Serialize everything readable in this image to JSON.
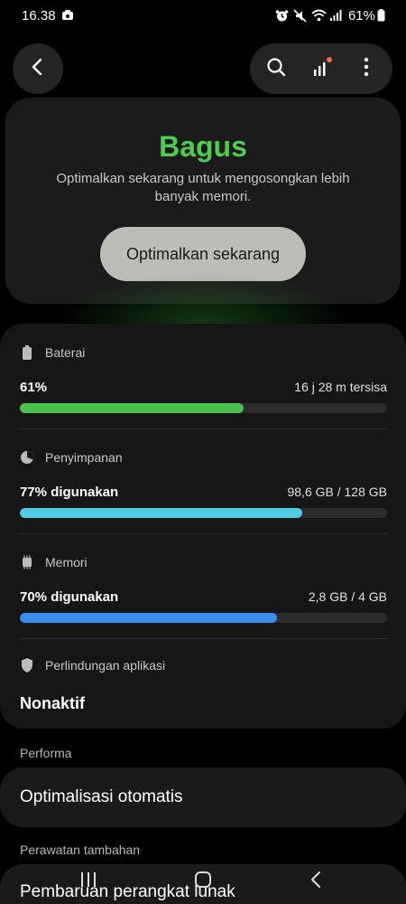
{
  "status_bar": {
    "time": "16.38",
    "battery_pct": "61%",
    "icons": [
      "notification-icon",
      "alarm-icon",
      "mute-icon",
      "wifi-icon",
      "signal-icon",
      "battery-icon"
    ]
  },
  "toolbar": {
    "back": "back-icon",
    "search": "search-icon",
    "stats": "stats-icon",
    "more": "more-icon"
  },
  "status": {
    "title": "Bagus",
    "description": "Optimalkan sekarang untuk mengosongkan lebih banyak memori.",
    "button_label": "Optimalkan sekarang",
    "color": "#4ecb52"
  },
  "battery": {
    "label": "Baterai",
    "value": "61%",
    "detail": "16 j 28 m tersisa",
    "fill_percent": 61,
    "color": "#49c24d"
  },
  "storage": {
    "label": "Penyimpanan",
    "value": "77% digunakan",
    "detail": "98,6 GB / 128 GB",
    "fill_percent": 77,
    "color": "#4ecde0"
  },
  "memory": {
    "label": "Memori",
    "value": "70% digunakan",
    "detail": "2,8 GB / 4 GB",
    "fill_percent": 70,
    "color": "#3b8ef0"
  },
  "app_protection": {
    "label": "Perlindungan aplikasi",
    "value": "Nonaktif"
  },
  "performance": {
    "section_label": "Performa",
    "item": "Optimalisasi otomatis"
  },
  "extra_care": {
    "section_label": "Perawatan tambahan",
    "item": "Pembaruan perangkat lunak"
  },
  "nav": {
    "recents": "recents-icon",
    "home": "home-icon",
    "back": "back-icon"
  }
}
